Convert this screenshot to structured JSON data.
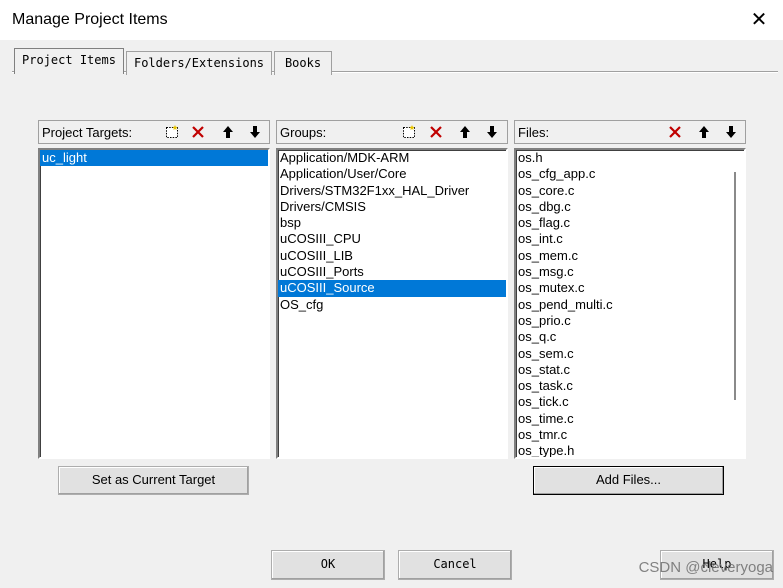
{
  "window": {
    "title": "Manage Project Items"
  },
  "tabs": [
    {
      "label": "Project Items",
      "active": true
    },
    {
      "label": "Folders/Extensions",
      "active": false
    },
    {
      "label": "Books",
      "active": false
    }
  ],
  "targets": {
    "header": "Project Targets:",
    "items": [
      "uc_light"
    ],
    "selected_index": 0,
    "button": "Set as Current Target"
  },
  "groups": {
    "header": "Groups:",
    "items": [
      "Application/MDK-ARM",
      "Application/User/Core",
      "Drivers/STM32F1xx_HAL_Driver",
      "Drivers/CMSIS",
      "bsp",
      "uCOSIII_CPU",
      "uCOSIII_LIB",
      "uCOSIII_Ports",
      "uCOSIII_Source",
      "OS_cfg"
    ],
    "selected_index": 8
  },
  "files": {
    "header": "Files:",
    "items": [
      "os.h",
      "os_cfg_app.c",
      "os_core.c",
      "os_dbg.c",
      "os_flag.c",
      "os_int.c",
      "os_mem.c",
      "os_msg.c",
      "os_mutex.c",
      "os_pend_multi.c",
      "os_prio.c",
      "os_q.c",
      "os_sem.c",
      "os_stat.c",
      "os_task.c",
      "os_tick.c",
      "os_time.c",
      "os_tmr.c",
      "os_type.h"
    ],
    "button": "Add Files..."
  },
  "footer": {
    "ok": "OK",
    "cancel": "Cancel",
    "help": "Help"
  },
  "watermark": "CSDN @cleveryoga",
  "colors": {
    "selection": "#0078d7",
    "delete_icon": "#c00000"
  }
}
